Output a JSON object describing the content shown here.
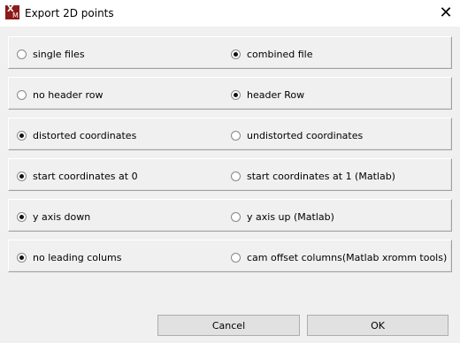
{
  "window": {
    "title": "Export 2D points",
    "icon": "xma-logo-icon",
    "close_glyph": "✕"
  },
  "options": [
    {
      "left": {
        "label": "single files",
        "checked": false
      },
      "right": {
        "label": "combined file",
        "checked": true
      }
    },
    {
      "left": {
        "label": "no header row",
        "checked": false
      },
      "right": {
        "label": "header Row",
        "checked": true
      }
    },
    {
      "left": {
        "label": "distorted coordinates",
        "checked": true
      },
      "right": {
        "label": "undistorted coordinates",
        "checked": false
      }
    },
    {
      "left": {
        "label": "start coordinates at 0",
        "checked": true
      },
      "right": {
        "label": "start coordinates at 1 (Matlab)",
        "checked": false
      }
    },
    {
      "left": {
        "label": "y axis down",
        "checked": true
      },
      "right": {
        "label": "y axis up (Matlab)",
        "checked": false
      }
    },
    {
      "left": {
        "label": "no leading colums",
        "checked": true
      },
      "right": {
        "label": "cam offset columns(Matlab xromm tools)",
        "checked": false
      }
    }
  ],
  "buttons": {
    "cancel": "Cancel",
    "ok": "OK"
  }
}
